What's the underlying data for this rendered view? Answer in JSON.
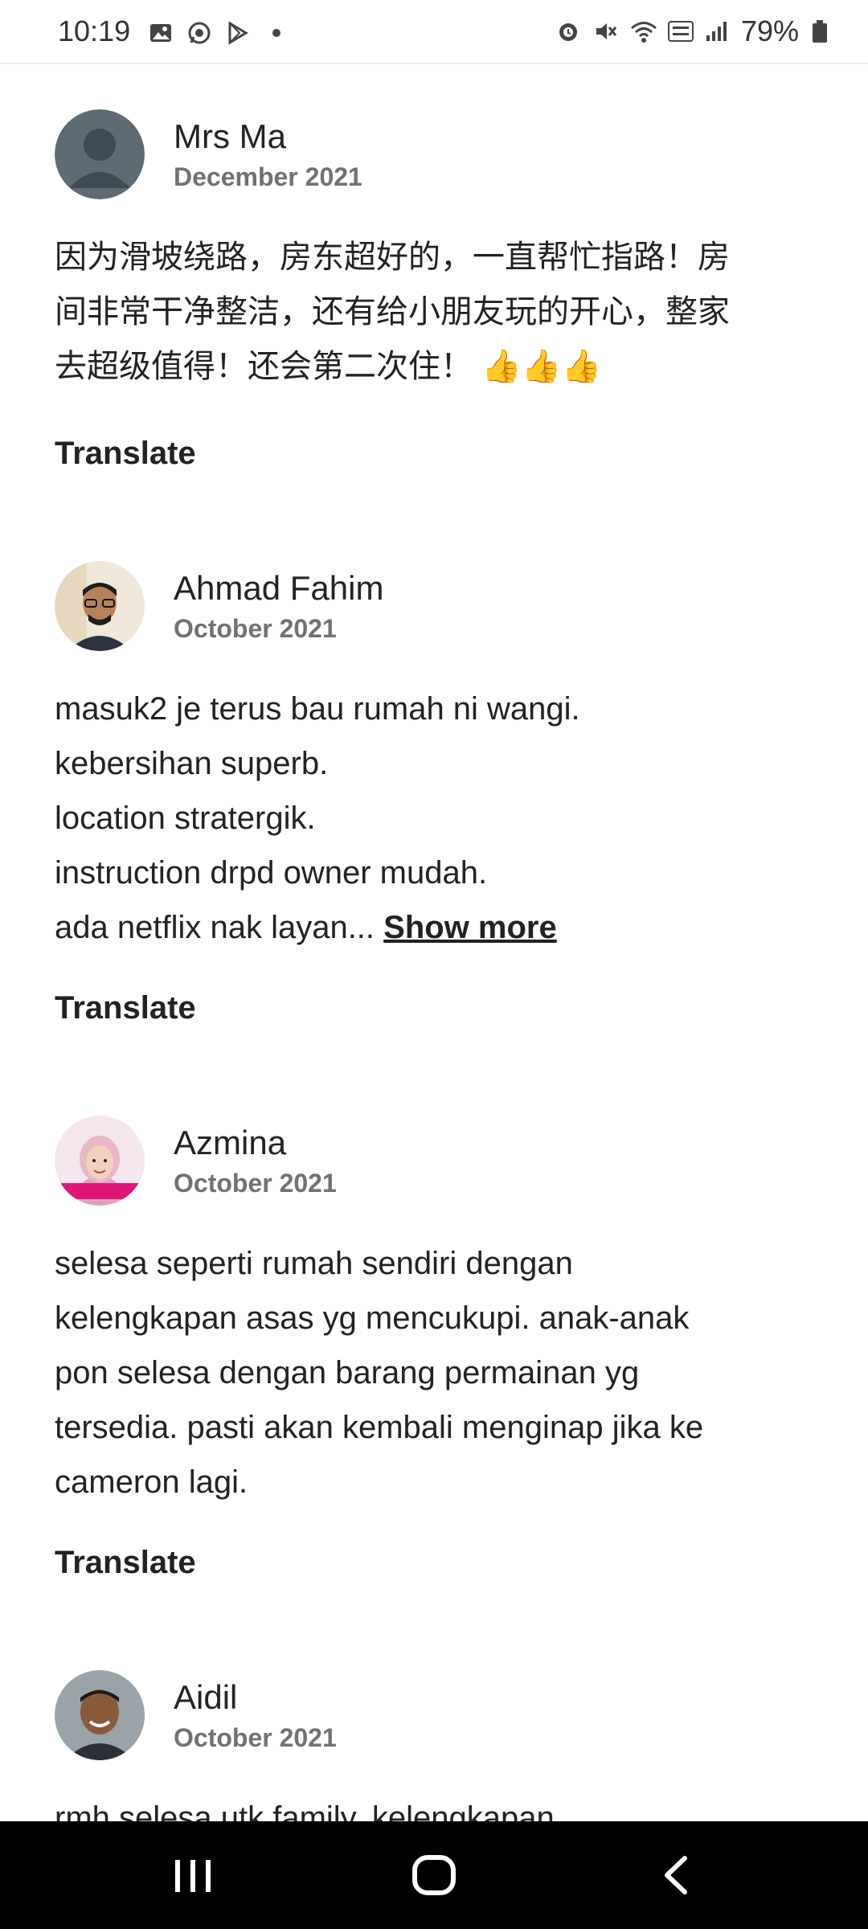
{
  "status_bar": {
    "time": "10:19",
    "battery": "79%",
    "left_icons": [
      "gallery-icon",
      "whatsapp-icon",
      "play-store-icon",
      "dot-icon"
    ],
    "right_icons": [
      "alarm-icon",
      "mute-icon",
      "wifi-icon",
      "volte-icon",
      "signal-icon",
      "battery-icon"
    ]
  },
  "reviews": [
    {
      "name": "Mrs Ma",
      "date": "December 2021",
      "body_lines": [
        "因为滑坡绕路，房东超好的，一直帮忙指路！房",
        "间非常干净整洁，还有给小朋友玩的开心，整家",
        "去超级值得！还会第二次住！"
      ],
      "emoji": "👍👍👍",
      "translate": "Translate"
    },
    {
      "name": "Ahmad Fahim",
      "date": "October 2021",
      "body_lines": [
        "masuk2 je terus bau rumah ni wangi.",
        "kebersihan superb.",
        "location stratergik.",
        "instruction drpd owner mudah.",
        "ada netflix nak layan..."
      ],
      "show_more": "Show more",
      "translate": "Translate"
    },
    {
      "name": "Azmina",
      "date": "October 2021",
      "body_lines": [
        "selesa seperti rumah sendiri dengan",
        "kelengkapan asas yg mencukupi. anak-anak",
        "pon selesa dengan barang permainan yg",
        "tersedia. pasti akan kembali menginap jika ke",
        "cameron lagi."
      ],
      "translate": "Translate"
    },
    {
      "name": "Aidil",
      "date": "October 2021",
      "body_lines": [
        "rmh selesa utk family. kelengkapan"
      ]
    }
  ],
  "nav_bar": {
    "buttons": [
      "recents-icon",
      "home-icon",
      "back-icon"
    ]
  }
}
